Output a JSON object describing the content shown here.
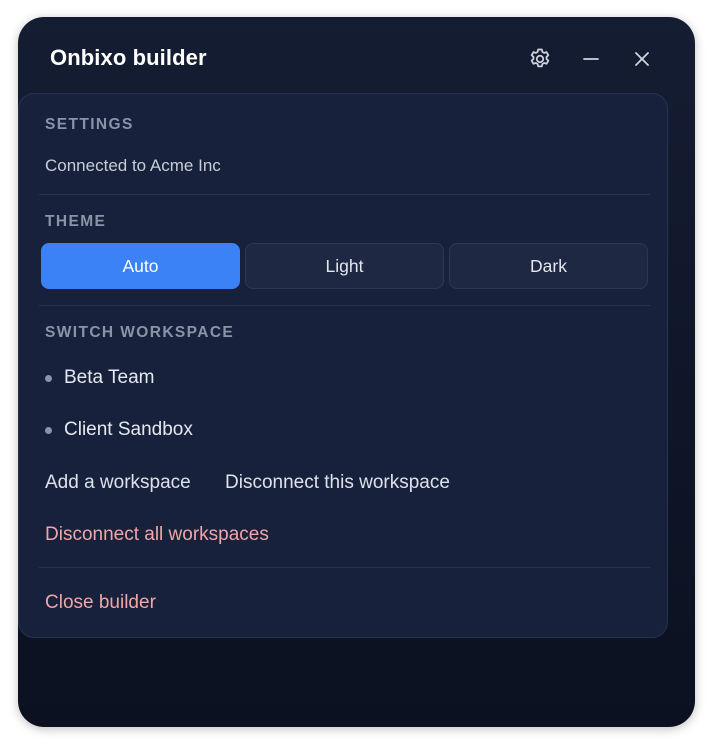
{
  "window": {
    "title": "Onbixo builder"
  },
  "header_icons": [
    "gear-icon",
    "minimize-icon",
    "close-icon"
  ],
  "settings": {
    "section_label": "SETTINGS",
    "connected_text": "Connected to Acme Inc"
  },
  "theme": {
    "section_label": "THEME",
    "options": [
      "Auto",
      "Light",
      "Dark"
    ],
    "selected": "Auto"
  },
  "workspace": {
    "section_label": "SWITCH WORKSPACE",
    "items": [
      "Beta Team",
      "Client Sandbox"
    ],
    "add_label": "Add a workspace",
    "disconnect_label": "Disconnect this workspace",
    "disconnect_all_label": "Disconnect all workspaces"
  },
  "footer": {
    "close_label": "Close builder"
  },
  "colors": {
    "accent": "#3b82f6",
    "danger_text": "#f1a5a5",
    "panel_bg": "#18213b",
    "window_bg": "#111a2e"
  }
}
